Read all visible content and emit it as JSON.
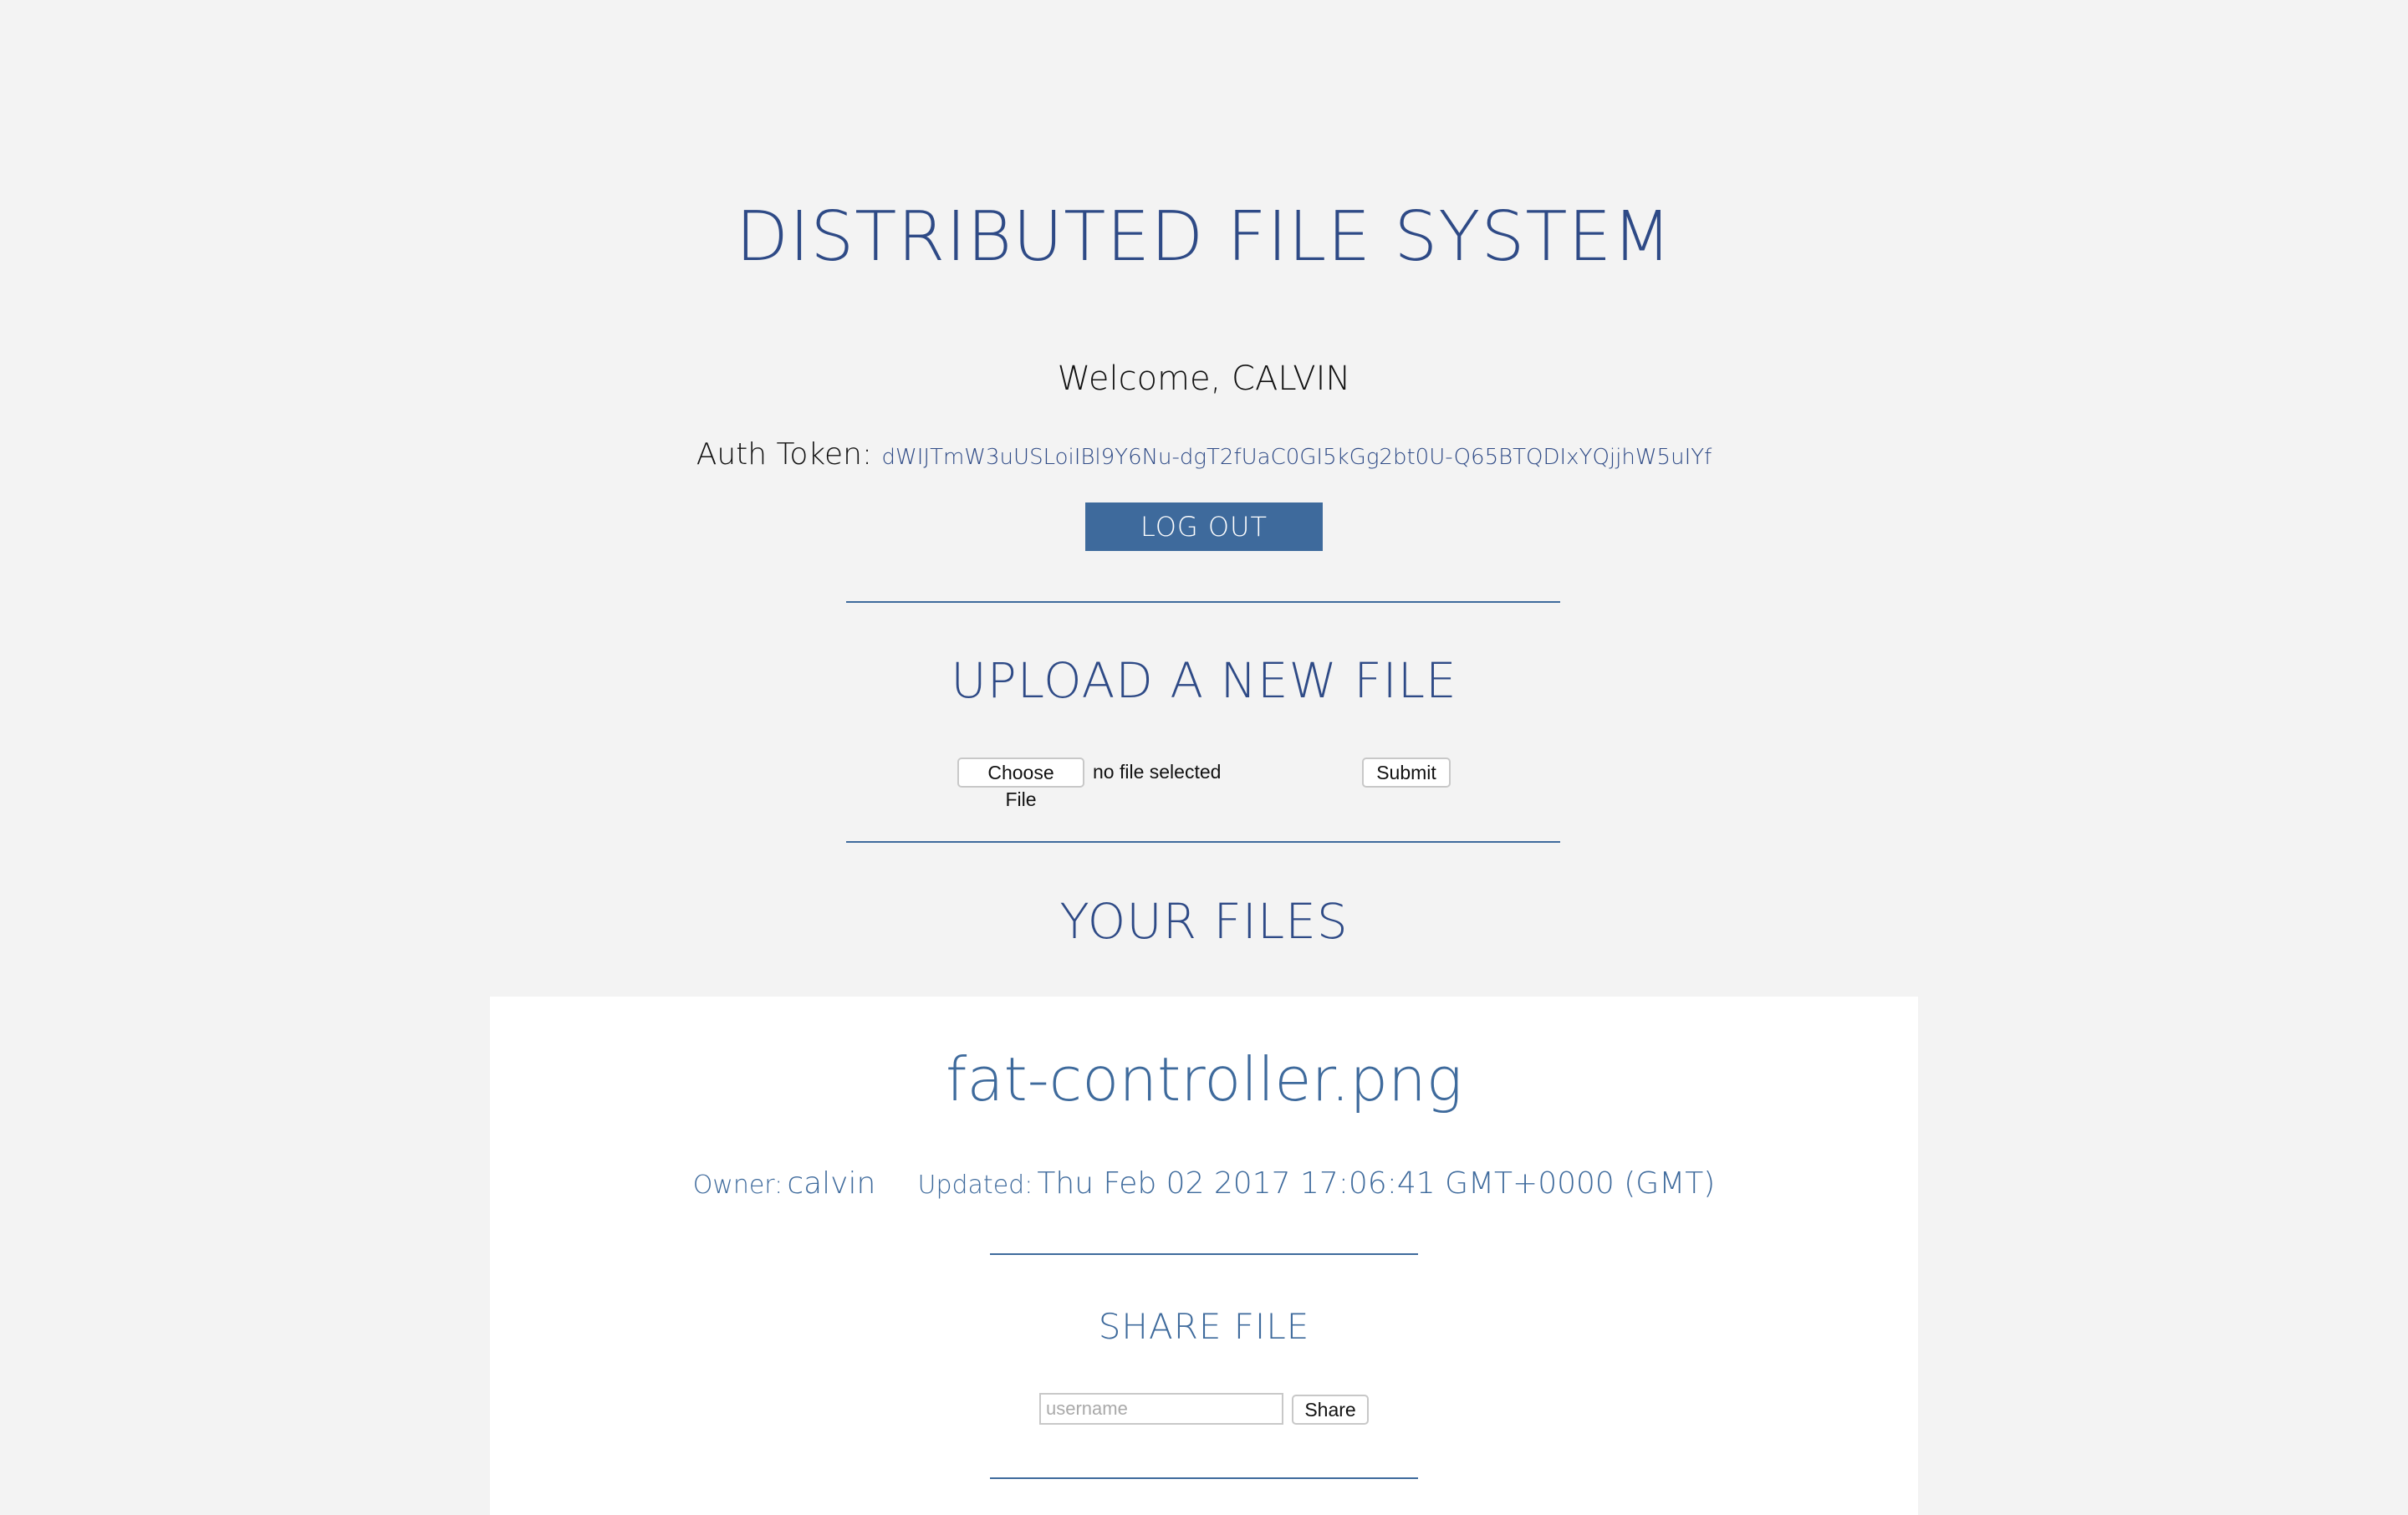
{
  "header": {
    "title": "DISTRIBUTED FILE SYSTEM",
    "welcome": "Welcome, CALVIN",
    "auth_label": "Auth Token:",
    "auth_token": "dWIJTmW3uUSLoiIBl9Y6Nu-dgT2fUaC0GI5kGg2bt0U-Q65BTQDIxYQjjhW5uIYf",
    "logout_label": "LOG OUT"
  },
  "upload": {
    "title": "UPLOAD A NEW FILE",
    "choose_label": "Choose File",
    "no_file_text": "no file selected",
    "submit_label": "Submit"
  },
  "files": {
    "title": "YOUR FILES",
    "items": [
      {
        "name": "fat-controller.png",
        "owner_label": "Owner:",
        "owner": "calvin",
        "updated_label": "Updated:",
        "updated": "Thu Feb 02 2017 17:06:41 GMT+0000 (GMT)",
        "share_title": "SHARE FILE",
        "share_placeholder": "username",
        "share_label": "Share"
      }
    ]
  },
  "colors": {
    "background": "#f3f3f3",
    "accent": "#3e6a9c",
    "heading": "#2e4a86",
    "card": "#ffffff"
  }
}
